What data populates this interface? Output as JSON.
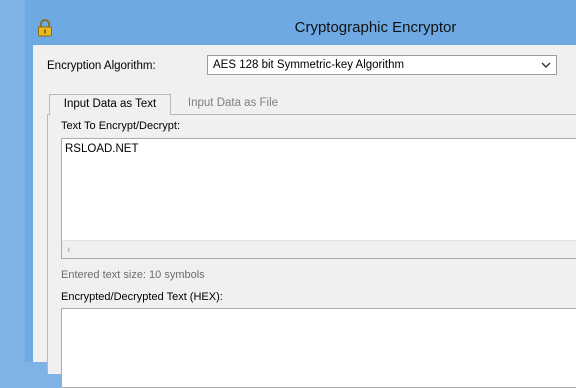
{
  "window": {
    "title": "Cryptographic Encryptor",
    "lock_icon": "lock-icon"
  },
  "algorithm": {
    "label": "Encryption Algorithm:",
    "selected": "AES 128 bit Symmetric-key Algorithm"
  },
  "tabs": [
    {
      "label": "Input Data as Text",
      "active": true
    },
    {
      "label": "Input Data as File",
      "active": false
    }
  ],
  "text_panel": {
    "input_label": "Text To Encrypt/Decrypt:",
    "input_value": "RSLOAD.NET",
    "size_label": "Entered text size: 10 symbols",
    "output_label": "Encrypted/Decrypted Text (HEX):",
    "output_value": ""
  },
  "colors": {
    "frame": "#6ea9e3",
    "client": "#f0f0f0"
  }
}
